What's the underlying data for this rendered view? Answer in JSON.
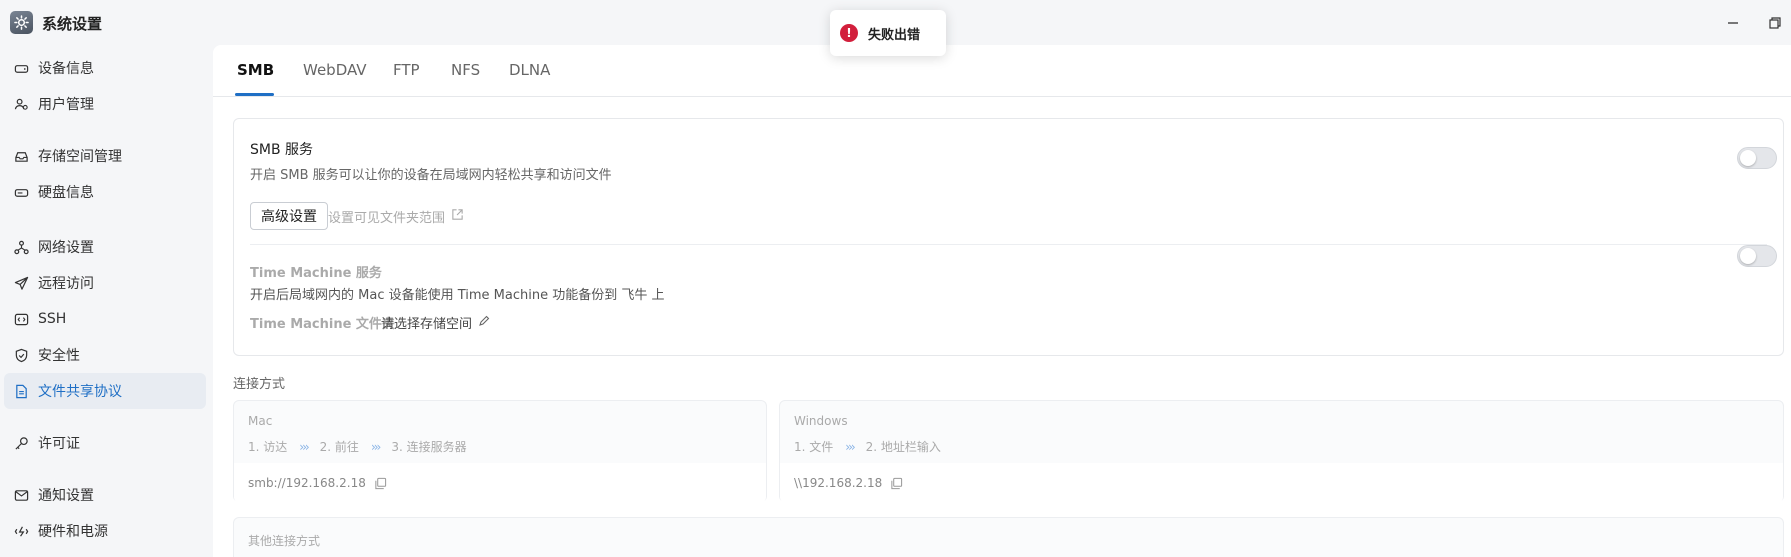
{
  "app": {
    "title": "系统设置"
  },
  "sidebar": {
    "items": [
      {
        "label": "设备信息",
        "icon": "drive-icon",
        "active": false
      },
      {
        "label": "用户管理",
        "icon": "users-icon",
        "active": false
      },
      {
        "label": "存储空间管理",
        "icon": "storage-icon",
        "active": false
      },
      {
        "label": "硬盘信息",
        "icon": "disk-icon",
        "active": false
      },
      {
        "label": "网络设置",
        "icon": "network-icon",
        "active": false
      },
      {
        "label": "远程访问",
        "icon": "send-icon",
        "active": false
      },
      {
        "label": "SSH",
        "icon": "code-icon",
        "active": false
      },
      {
        "label": "安全性",
        "icon": "shield-icon",
        "active": false
      },
      {
        "label": "文件共享协议",
        "icon": "document-icon",
        "active": true
      },
      {
        "label": "许可证",
        "icon": "key-icon",
        "active": false
      },
      {
        "label": "通知设置",
        "icon": "mail-icon",
        "active": false
      },
      {
        "label": "硬件和电源",
        "icon": "power-icon",
        "active": false
      }
    ]
  },
  "tabs": [
    "SMB",
    "WebDAV",
    "FTP",
    "NFS",
    "DLNA"
  ],
  "active_tab": "SMB",
  "smb": {
    "title": "SMB 服务",
    "description": "开启 SMB 服务可以让你的设备在局域网内轻松共享和访问文件",
    "enabled": false,
    "advanced_button": "高级设置",
    "visible_folders_link": "设置可见文件夹范围"
  },
  "time_machine": {
    "title": "Time Machine 服务",
    "description": "开启后局域网内的 Mac 设备能使用 Time Machine 功能备份到 飞牛 上",
    "enabled": false,
    "folder_label": "Time Machine 文件夹",
    "folder_value": "请选择存储空间"
  },
  "connection": {
    "heading": "连接方式",
    "mac": {
      "os": "Mac",
      "steps": [
        "1. 访达",
        "2. 前往",
        "3. 连接服务器"
      ],
      "address": "smb://192.168.2.18"
    },
    "windows": {
      "os": "Windows",
      "steps": [
        "1. 文件",
        "2. 地址栏输入"
      ],
      "address": "\\\\192.168.2.18"
    },
    "other_heading": "其他连接方式"
  },
  "toast": {
    "message": "失败出错",
    "type": "error"
  },
  "colors": {
    "accent": "#1f6fc5",
    "error": "#d21f3c"
  }
}
